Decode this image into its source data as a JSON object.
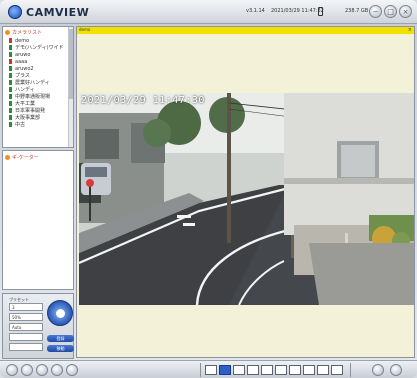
{
  "app": {
    "name": "CAMVIEW",
    "version": "v3.1.14",
    "datetime": "2021/03/29 11:47:32",
    "disk": "238.7 GB"
  },
  "camera_tree": {
    "root_label": "カメラリスト",
    "items": [
      "demo",
      "デモ(ハンディ)ワイド",
      "aruwo",
      "aaaa",
      "aruwo2",
      "プラス",
      "農業好ハンディ",
      "ハンディ",
      "中野車通販現場",
      "大平工業",
      "日本軍事開発",
      "大阪事業部",
      "中古"
    ]
  },
  "group_tree": {
    "root_label": "ギ-ケーター"
  },
  "ptz": {
    "preset_label": "プリセット",
    "speed_value": "3",
    "zoom_label": "50%",
    "focus_label": "Auto",
    "save_button": "登録",
    "call_button": "移動"
  },
  "viewer": {
    "bar_label": "demo",
    "timestamp": "2021/03/29 11:47:30",
    "close_icon": "×"
  },
  "colors": {
    "accent": "#2b5fc7",
    "viewer_bar": "#f2e100",
    "panel_bg": "#f3f1d8"
  }
}
